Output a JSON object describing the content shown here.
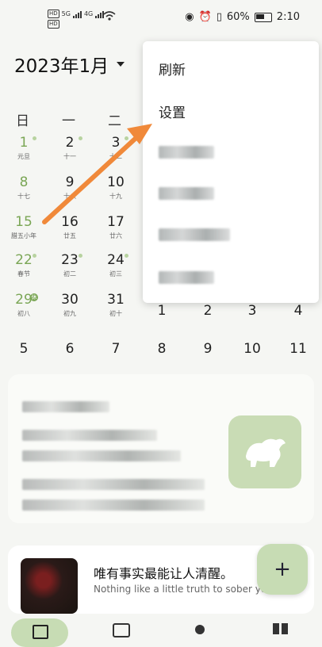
{
  "status_bar": {
    "left_hd": [
      "HD",
      "HD"
    ],
    "left_labels": [
      "5G",
      "4G"
    ],
    "battery_pct": "60%",
    "time": "2:10"
  },
  "calendar": {
    "month_title": "2023年1月",
    "weekdays": [
      "日",
      "一",
      "二"
    ],
    "rows": [
      [
        {
          "n": "1",
          "l": "元旦",
          "g": true,
          "dot": true
        },
        {
          "n": "2",
          "l": "十一",
          "dot": true
        },
        {
          "n": "3",
          "l": "十二",
          "dot": true
        }
      ],
      [
        {
          "n": "8",
          "l": "十七",
          "g": true
        },
        {
          "n": "9",
          "l": "十八"
        },
        {
          "n": "10",
          "l": "十九"
        }
      ],
      [
        {
          "n": "15",
          "l": "腊五小年",
          "g": true
        },
        {
          "n": "16",
          "l": "廿五"
        },
        {
          "n": "17",
          "l": "廿六"
        }
      ],
      [
        {
          "n": "22",
          "l": "春节",
          "g": true,
          "dot": true
        },
        {
          "n": "23",
          "l": "初二",
          "dot": true
        },
        {
          "n": "24",
          "l": "初三",
          "dot": true
        }
      ],
      [
        {
          "n": "29",
          "l": "初八",
          "g": true,
          "badge": "休"
        },
        {
          "n": "30",
          "l": "初九"
        },
        {
          "n": "31",
          "l": "初十"
        }
      ]
    ],
    "row5_right": [
      "1",
      "2",
      "3",
      "4"
    ],
    "next_week": [
      "5",
      "6",
      "7",
      "8",
      "9",
      "10",
      "11"
    ]
  },
  "menu": {
    "refresh_label": "刷新",
    "settings_label": "设置"
  },
  "quote": {
    "cn": "唯有事实最能让人清醒。",
    "en": "Nothing like a little truth to sober you up."
  },
  "fab_label": "+"
}
